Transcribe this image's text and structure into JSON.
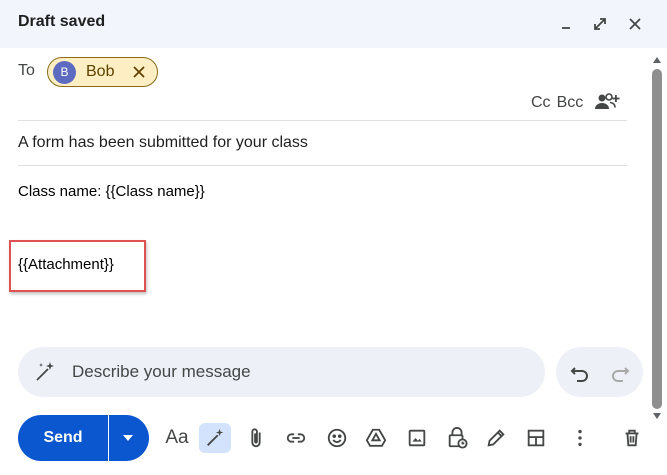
{
  "header": {
    "title": "Draft saved"
  },
  "recipients": {
    "to_label": "To",
    "chips": [
      {
        "initial": "B",
        "name": "Bob"
      }
    ],
    "cc_label": "Cc",
    "bcc_label": "Bcc"
  },
  "subject": "A form has been submitted for your class",
  "body": {
    "line1": "Class name: {{Class name}}",
    "line2": "{{Attachment}}"
  },
  "help_me_write": {
    "placeholder": "Describe your message"
  },
  "toolbar": {
    "send_label": "Send",
    "formatting_label": "Aa"
  },
  "colors": {
    "header_bg": "#f2f6fc",
    "send_button": "#0b57d0",
    "chip_bg": "#fdefc3",
    "avatar": "#5c6bc0",
    "highlight_box": "#e05252"
  }
}
